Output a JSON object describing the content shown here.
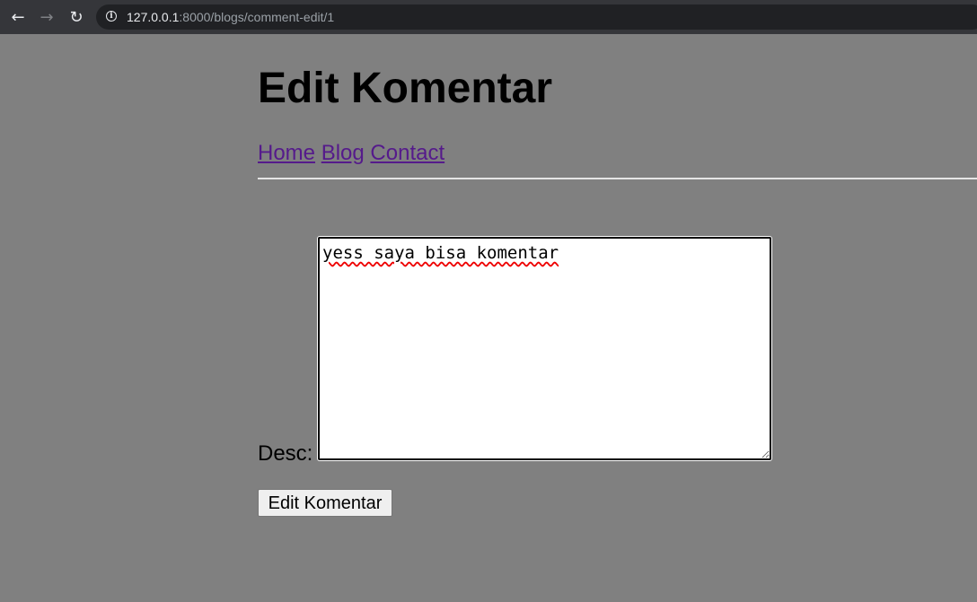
{
  "browser": {
    "url_host": "127.0.0.1",
    "url_rest": ":8000/blogs/comment-edit/1"
  },
  "page": {
    "title": "Edit Komentar",
    "nav": {
      "home": "Home",
      "blog": "Blog",
      "contact": "Contact"
    },
    "form": {
      "desc_label": "Desc:",
      "desc_value": "yess saya bisa komentar",
      "submit_label": "Edit Komentar"
    }
  }
}
